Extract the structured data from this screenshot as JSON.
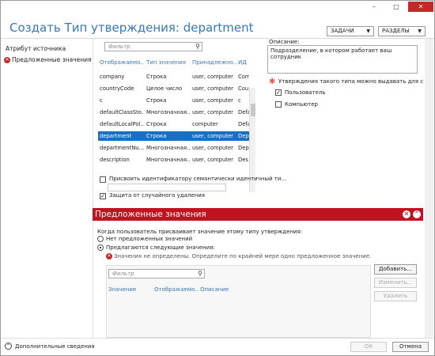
{
  "window": {
    "minimize": "–",
    "maximize": "□",
    "close": "✕"
  },
  "heading": "Создать Тип утверждения: department",
  "top_buttons": {
    "tasks": "ЗАДАЧИ",
    "sections": "РАЗДЕЛЫ"
  },
  "sidebar": {
    "items": [
      {
        "label": "Атрибут источника",
        "error": false
      },
      {
        "label": "Предложенные значения",
        "error": true
      }
    ]
  },
  "attr_list": {
    "filter_placeholder": "Фильтр",
    "columns": [
      "Отображаемо...",
      "Тип значения",
      "Принадлежно...",
      "ИД"
    ],
    "rows": [
      {
        "c1": "company",
        "c2": "Строка",
        "c3": "user, computer",
        "c4": "Com",
        "selected": false
      },
      {
        "c1": "countryCode",
        "c2": "Целое число",
        "c3": "user, computer",
        "c4": "Cou",
        "selected": false
      },
      {
        "c1": "c",
        "c2": "Строка",
        "c3": "user, computer",
        "c4": "c",
        "selected": false
      },
      {
        "c1": "defaultClassSto...",
        "c2": "Многозначная...",
        "c3": "user, computer",
        "c4": "Defa",
        "selected": false
      },
      {
        "c1": "defaultLocalPol...",
        "c2": "Строка",
        "c3": "computer",
        "c4": "Defa",
        "selected": false
      },
      {
        "c1": "department",
        "c2": "Строка",
        "c3": "user, computer",
        "c4": "Dep",
        "selected": true
      },
      {
        "c1": "departmentNu...",
        "c2": "Многозначная...",
        "c3": "user, computer",
        "c4": "Dep",
        "selected": false
      },
      {
        "c1": "description",
        "c2": "Многозначная...",
        "c3": "user, computer",
        "c4": "Des",
        "selected": false
      }
    ]
  },
  "description": {
    "label": "Описание:",
    "value": "Подразделение, в котором работает ваш сотрудник"
  },
  "issue": {
    "label": "Утверждения такого типа можно выдавать для следую",
    "user": "Пользователь",
    "computer": "Компьютер",
    "user_checked": true,
    "computer_checked": false
  },
  "semantic": {
    "label": "Присвоить идентификатору семантически идентичный ти...",
    "checked": false
  },
  "protect": {
    "label": "Защита от случайного удаления",
    "checked": true
  },
  "suggested": {
    "header": "Предложенные значения",
    "question": "Когда пользователь присваивает значение этому типу утверждения:",
    "opt_none": "Нет предложенных значений",
    "opt_suggest": "Предлагаются следующие значения:",
    "error": "Значения не определены. Определите по крайней мере одно предложенное значение.",
    "filter_placeholder": "Фильтр",
    "columns": [
      "Значение",
      "Отображаемо...",
      "Описание"
    ],
    "buttons": {
      "add": "Добавить...",
      "edit": "Изменить...",
      "delete": "Удалить"
    }
  },
  "footer": {
    "more": "Дополнительные сведения",
    "ok": "ОК",
    "cancel": "Отмена"
  }
}
